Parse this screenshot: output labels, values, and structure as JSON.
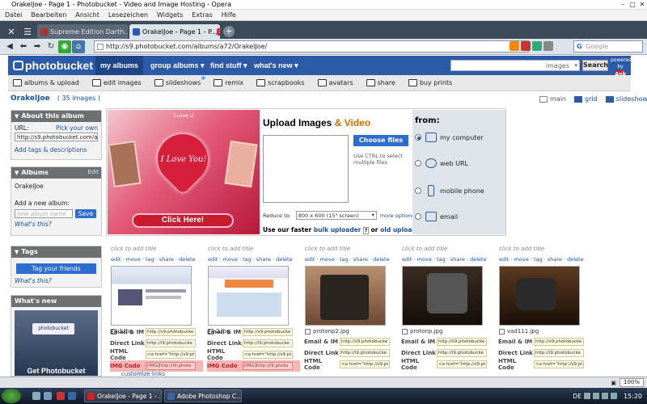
{
  "window": {
    "title": "OrakelJoe - Page 1 - Photobucket - Video and Image Hosting - Opera",
    "minimize": "–",
    "maximize": "□",
    "close": "✕"
  },
  "menu": [
    "Datei",
    "Bearbeiten",
    "Ansicht",
    "Lesezeichen",
    "Widgets",
    "Extras",
    "Hilfe"
  ],
  "tabs": [
    {
      "label": "Supreme Edition Darth...",
      "active": false
    },
    {
      "label": "OrakelJoe - Page 1 - P...",
      "active": true
    }
  ],
  "nav": {
    "address": "http://s9.photobucket.com/albums/a72/OrakelJoe/",
    "search_placeholder": "Google"
  },
  "photobucket": {
    "logo": "photobucket",
    "nav": [
      "my albums",
      "group albums ▾",
      "find stuff ▾",
      "what's new ▾"
    ],
    "search_scope": "images",
    "search_button": "Search",
    "powered_by": "powered by",
    "ask": "Ask",
    "subnav": [
      "albums & upload",
      "edit images",
      "slideshows",
      "remix",
      "scrapbooks",
      "avatars",
      "share",
      "buy prints"
    ]
  },
  "user": {
    "name": "OrakelJoe",
    "count": "( 35 images )"
  },
  "viewmodes": [
    "main",
    "grid",
    "slideshow"
  ],
  "sidebar": {
    "about": {
      "title": "About this album",
      "url_label": "URL:",
      "pick_link": "Pick your own",
      "url_value": "http://s9.photobucket.com/albums/a72/OrakelJoe/",
      "tags_link": "Add tags & descriptions"
    },
    "albums": {
      "title": "Albums",
      "edit": "Edit",
      "current": "OrakelJoe",
      "add_label": "Add a new album:",
      "add_placeholder": "new album name",
      "save": "Save",
      "whats_this": "What's this?"
    },
    "tags": {
      "title": "Tags",
      "button": "Tag your friends",
      "whats_this": "What's this?"
    },
    "whatsnew": {
      "title": "What's new",
      "promo": "Get Photobucket"
    }
  },
  "upload": {
    "promo_small": "I Love U",
    "promo_heart": "I Love You!",
    "promo_button": "Click Here!",
    "title_a": "Upload Images",
    "title_amp": "&",
    "title_b": "Video",
    "choose": "Choose files",
    "ctrl_note": "Use CTRL to select multiple files",
    "reduce_label": "Reduce to:",
    "reduce_value": "800 x 600 (15\" screen)",
    "more_options": "more options",
    "faster_a": "Use our faster",
    "faster_link": "bulk uploader",
    "faster_q": "?",
    "faster_or": "or",
    "old_link": "old uploader",
    "from": "from:",
    "sources": [
      "my computer",
      "web URL",
      "mobile phone",
      "email"
    ]
  },
  "thumbs": [
    {
      "title": "click to add title",
      "actions": "edit · move · tag · share · delete",
      "file": "1.jpg"
    },
    {
      "title": "click to add title",
      "actions": "edit · move · tag · share · delete",
      "file": "2.jpg"
    },
    {
      "title": "click to add title",
      "actions": "edit · move · tag · share · delete",
      "file": "protonp2.jpg"
    },
    {
      "title": "click to add title",
      "actions": "edit · move · tag · share · delete",
      "file": "protonp.jpg"
    },
    {
      "title": "click to add title",
      "actions": "edit · move · tag · share · delete",
      "file": "vad111.jpg"
    }
  ],
  "code_labels": [
    "Email & IM",
    "Direct Link",
    "HTML Code",
    "IMG Code"
  ],
  "code_values": [
    "http://s9.photobucke",
    "http://i9.photobucke",
    "<a href=\"http://s9.pt",
    "[IMG]http://i9.photo"
  ],
  "customize_link": "customize links",
  "zoom": "100%",
  "taskbar": {
    "btn1": "OrakelJoe - Page 1 - ...",
    "btn2": "Adobe Photoshop C...",
    "lang": "DE",
    "clock": "15:20"
  }
}
